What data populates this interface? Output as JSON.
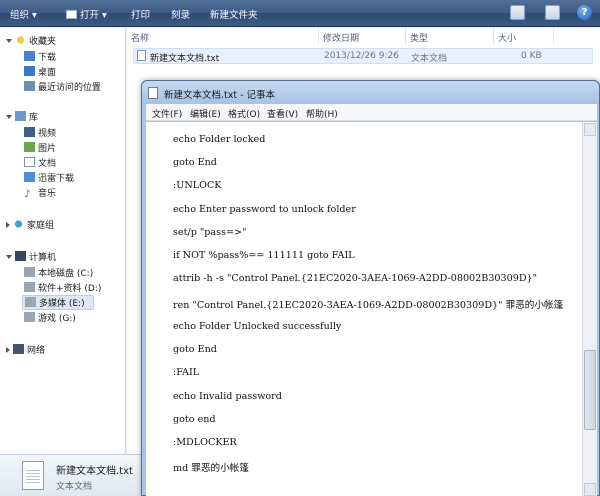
{
  "toolbar": {
    "organize": "组织",
    "open": "打开",
    "print": "打印",
    "burn": "刻录",
    "new_folder": "新建文件夹",
    "help": "?"
  },
  "nav": {
    "favorites": {
      "label": "收藏夹",
      "items": [
        "下载",
        "桌面",
        "最近访问的位置"
      ]
    },
    "libraries": {
      "label": "库",
      "items": [
        "视频",
        "图片",
        "文档",
        "迅雷下载",
        "音乐"
      ]
    },
    "homegroup": "家庭组",
    "computer": {
      "label": "计算机",
      "items": [
        "本地磁盘 (C:)",
        "软件+资料 (D:)",
        "多媒体 (E:)",
        "游戏 (G:)"
      ]
    },
    "network": "网络"
  },
  "columns": [
    "名称",
    "修改日期",
    "类型",
    "大小"
  ],
  "file": {
    "name": "新建文本文档.txt",
    "modified": "2013/12/26 9:26",
    "type": "文本文档",
    "size": "0 KB"
  },
  "details": {
    "name": "新建文本文档.txt",
    "type": "文本文档"
  },
  "notepad": {
    "title": "新建文本文档.txt - 记事本",
    "menu": [
      "文件(F)",
      "编辑(E)",
      "格式(O)",
      "查看(V)",
      "帮助(H)"
    ],
    "lines": [
      "echo Folder locked",
      "goto End",
      ":UNLOCK",
      "echo Enter password to unlock folder",
      "set/p \"pass=>\"",
      "if NOT %pass%== 111111 goto FAIL",
      "attrib -h -s \"Control Panel.{21EC2020-3AEA-1069-A2DD-08002B30309D}\"",
      "ren \"Control Panel.{21EC2020-3AEA-1069-A2DD-08002B30309D}\" 罪恶的小帐篷",
      "echo Folder Unlocked successfully",
      "goto End",
      ":FAIL",
      "echo Invalid password",
      "goto end",
      ":MDLOCKER",
      "md 罪恶的小帐篷"
    ]
  },
  "colors": {
    "toolbar": "#3b5a85",
    "selection": "#dbe7f6",
    "window_frame": "#a8c4e6"
  }
}
